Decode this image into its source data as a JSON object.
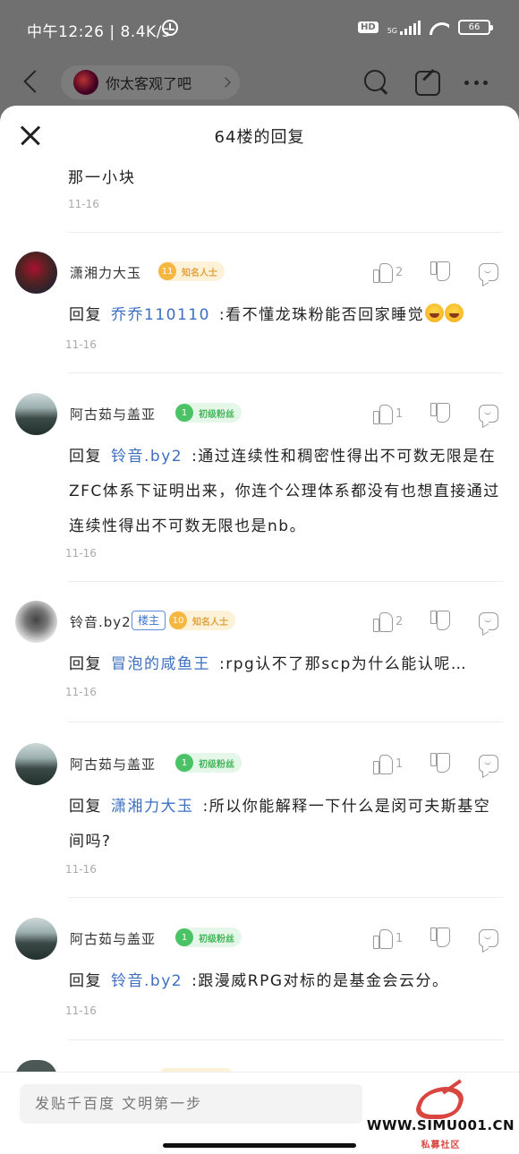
{
  "status_bar": {
    "time": "中午12:26 | 8.4K/s",
    "hd": "HD",
    "network": "5G",
    "battery": "66"
  },
  "nav": {
    "forum_name": "你太客观了吧"
  },
  "sheet": {
    "title": "64楼的回复",
    "top_fragment_text": "那一小块",
    "top_fragment_date": "11-16"
  },
  "replies": [
    {
      "username": "潇湘力大玉",
      "level": "11",
      "title_badge": "知名人士",
      "badge_color": "#f5b740",
      "likes": "2",
      "reply_word": "回复",
      "reply_to": "乔乔110110",
      "text": ":看不懂龙珠粉能否回家睡觉",
      "emoji": "rofl-emoji",
      "date": "11-16"
    },
    {
      "username": "阿古茹与盖亚",
      "level": "1",
      "title_badge": "初级粉丝",
      "badge_color": "#4cc266",
      "likes": "1",
      "reply_word": "回复",
      "reply_to": "铃音.by2",
      "text": ":通过连续性和稠密性得出不可数无限是在ZFC体系下证明出来，你连个公理体系都没有也想直接通过连续性得出不可数无限也是nb。",
      "date": "11-16"
    },
    {
      "username": "铃音.by2",
      "host_label": "楼主",
      "level": "10",
      "title_badge": "知名人士",
      "badge_color": "#f5b740",
      "likes": "2",
      "reply_word": "回复",
      "reply_to": "冒泡的咸鱼王",
      "text": ":rpg认不了那scp为什么能认呢…",
      "date": "11-16"
    },
    {
      "username": "阿古茹与盖亚",
      "level": "1",
      "title_badge": "初级粉丝",
      "badge_color": "#4cc266",
      "likes": "1",
      "reply_word": "回复",
      "reply_to": "潇湘力大玉",
      "text": ":所以你能解释一下什么是闵可夫斯基空间吗?",
      "date": "11-16"
    },
    {
      "username": "阿古茹与盖亚",
      "level": "1",
      "title_badge": "初级粉丝",
      "badge_color": "#4cc266",
      "likes": "1",
      "reply_word": "回复",
      "reply_to": "铃音.by2",
      "text": ":跟漫威RPG对标的是基金会云分。",
      "date": "11-16"
    }
  ],
  "bottom": {
    "input_placeholder": "发贴千百度 文明第一步"
  },
  "watermark": {
    "url": "WWW.SIMU001.CN",
    "name": "私募社区"
  }
}
